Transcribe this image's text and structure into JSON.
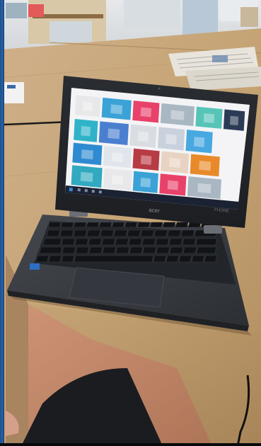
{
  "scene": {
    "subject": "laptop-on-table",
    "colors": {
      "table": "#c9a878",
      "table_dark": "#a88658",
      "laptop_body": "#3a3d42",
      "laptop_dark": "#24272b",
      "screen_bg": "#f4f4f6",
      "taskbar": "#1b2233",
      "window_frame": "#1d4f8c",
      "floor_rug": "#c97f6a"
    }
  },
  "laptop": {
    "brand_logo": "acer",
    "corner_logo": "FHONE"
  },
  "screen": {
    "gallery_tiles": [
      {
        "icon": "product-photo-1",
        "color": "#e8e8ea"
      },
      {
        "icon": "product-photo-2",
        "color": "#3aa2d6"
      },
      {
        "icon": "product-photo-3",
        "color": "#e8426a"
      },
      {
        "icon": "product-photo-4",
        "color": "#a9b7c3"
      },
      {
        "icon": "product-photo-5",
        "color": "#57c4b8"
      },
      {
        "icon": "product-photo-6",
        "color": "#2c3b55"
      },
      {
        "icon": "product-photo-7",
        "color": "#2fb3c8"
      },
      {
        "icon": "product-photo-8",
        "color": "#4a7fd0"
      },
      {
        "icon": "product-photo-9",
        "color": "#d9dde2"
      },
      {
        "icon": "product-photo-10",
        "color": "#c9d2dc"
      },
      {
        "icon": "product-photo-11",
        "color": "#48a8e0"
      },
      {
        "icon": "product-photo-12",
        "color": "#2f8bd1"
      },
      {
        "icon": "product-photo-13",
        "color": "#dfe5ea"
      },
      {
        "icon": "product-photo-14",
        "color": "#b83b44"
      },
      {
        "icon": "product-photo-15",
        "color": "#e8d3c2"
      },
      {
        "icon": "product-photo-16",
        "color": "#e88a2a"
      },
      {
        "icon": "product-photo-17",
        "color": "#31a9c0"
      }
    ]
  }
}
